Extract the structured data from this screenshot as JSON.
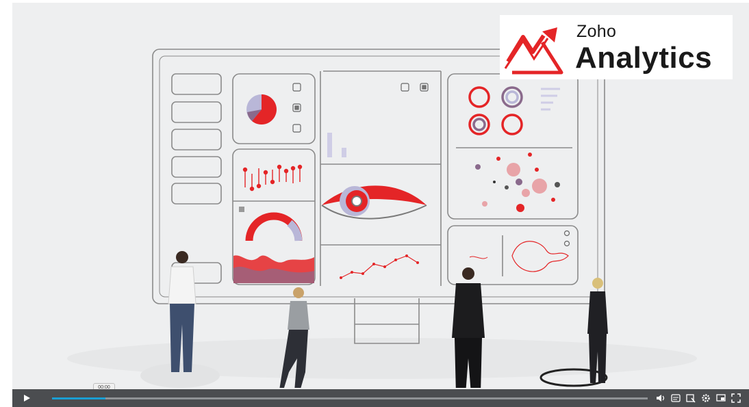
{
  "video": {
    "timestamp": "00:00",
    "progress": 0.09
  },
  "logo": {
    "small": "Zoho",
    "big": "Analytics",
    "accent": "#e42527"
  },
  "colors": {
    "accent_red": "#e42527",
    "lavender": "#b9b7d8",
    "line": "#7a7a7a",
    "controls_bg": "#4b4d50",
    "progress_fill": "#1a9fd4"
  },
  "controls": {
    "icons": [
      "volume-icon",
      "captions-icon",
      "chapters-icon",
      "settings-icon",
      "pip-icon",
      "fullscreen-icon"
    ]
  }
}
